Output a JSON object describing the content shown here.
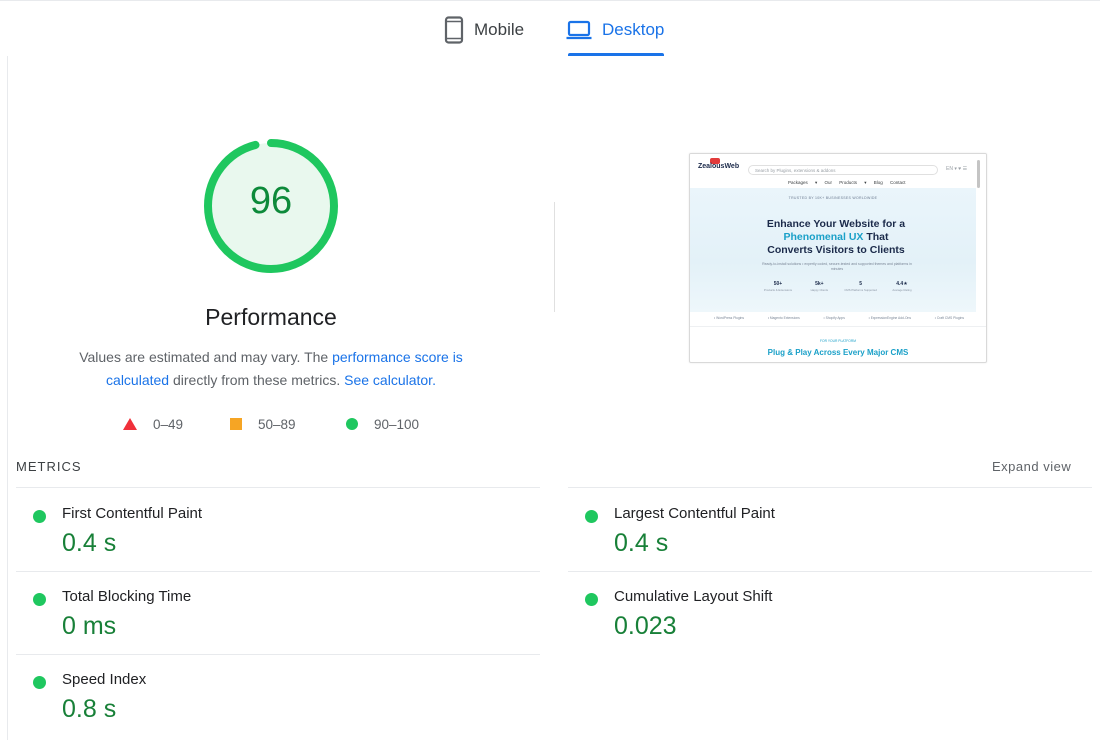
{
  "tabs": {
    "mobile": "Mobile",
    "desktop": "Desktop",
    "active": "Desktop",
    "accent": "#1a73e8"
  },
  "score": {
    "value": "96",
    "fraction": 0.96,
    "label": "Performance",
    "color": "#1fc75f"
  },
  "description": {
    "text1": "Values are estimated and may vary. The ",
    "link1": "performance score is calculated",
    "text2": " directly from these metrics. ",
    "link2": "See calculator."
  },
  "legend": [
    {
      "range": "0–49",
      "shape": "triangle",
      "color": "#f0303a"
    },
    {
      "range": "50–89",
      "shape": "square",
      "color": "#f6a524"
    },
    {
      "range": "90–100",
      "shape": "circle",
      "color": "#1fc75f"
    }
  ],
  "thumbnail": {
    "logo": "ZealousWeb",
    "search": "Search by Plugins, extensions & addons",
    "icons": "EN ▾ ♥ ☰",
    "nav": "Packages ▾  Our Products ▾  Blog  Contact",
    "kicker": "TRUSTED BY 10K+ BUSINESSES WORLDWIDE",
    "headline1": "Enhance Your Website for a",
    "headline2_accent": "Phenomenal UX",
    "headline2_rest": " That",
    "headline3": "Converts Visitors to Clients",
    "sub": "Ready-to-install solutions • expertly coded, secure-tested and supported themes and platforms in minutes",
    "stats": [
      {
        "value": "50+",
        "caption": "Products & Extensions"
      },
      {
        "value": "5k+",
        "caption": "Happy Clients"
      },
      {
        "value": "5",
        "caption": "CMS Platforms Supported"
      },
      {
        "value": "4.4★",
        "caption": "Average Rating"
      }
    ],
    "plugins": [
      "• WordPress Plugins",
      "• Magento Extensions",
      "• Shopify Apps",
      "• ExpressionEngine Add-Ons",
      "• Craft CMS Plugins"
    ],
    "section_kicker": "FOR YOUR PLATFORM",
    "section_title": "Plug & Play Across Every Major CMS"
  },
  "metrics": {
    "title": "METRICS",
    "expand": "Expand view",
    "items": [
      {
        "name": "First Contentful Paint",
        "value": "0.4 s",
        "status": "good"
      },
      {
        "name": "Largest Contentful Paint",
        "value": "0.4 s",
        "status": "good"
      },
      {
        "name": "Total Blocking Time",
        "value": "0 ms",
        "status": "good"
      },
      {
        "name": "Cumulative Layout Shift",
        "value": "0.023",
        "status": "good"
      },
      {
        "name": "Speed Index",
        "value": "0.8 s",
        "status": "good"
      }
    ]
  }
}
